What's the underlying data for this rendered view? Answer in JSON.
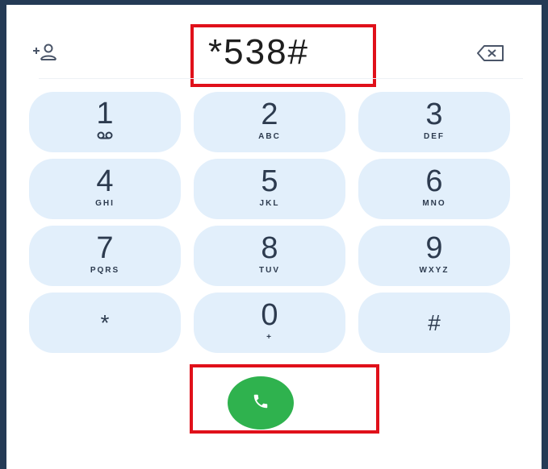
{
  "dialer": {
    "number": "*538#",
    "add_contact_icon": "add-contact-icon",
    "backspace_icon": "backspace-icon",
    "call_icon": "phone-icon",
    "call_color": "#2fb24e",
    "highlight_color": "#e0101a",
    "key_color": "#e2effb"
  },
  "keypad": {
    "keys": [
      {
        "digit": "1",
        "sub": "voicemail"
      },
      {
        "digit": "2",
        "sub": "ABC"
      },
      {
        "digit": "3",
        "sub": "DEF"
      },
      {
        "digit": "4",
        "sub": "GHI"
      },
      {
        "digit": "5",
        "sub": "JKL"
      },
      {
        "digit": "6",
        "sub": "MNO"
      },
      {
        "digit": "7",
        "sub": "PQRS"
      },
      {
        "digit": "8",
        "sub": "TUV"
      },
      {
        "digit": "9",
        "sub": "WXYZ"
      },
      {
        "digit": "*",
        "sub": ""
      },
      {
        "digit": "0",
        "sub": "+"
      },
      {
        "digit": "#",
        "sub": ""
      }
    ]
  }
}
